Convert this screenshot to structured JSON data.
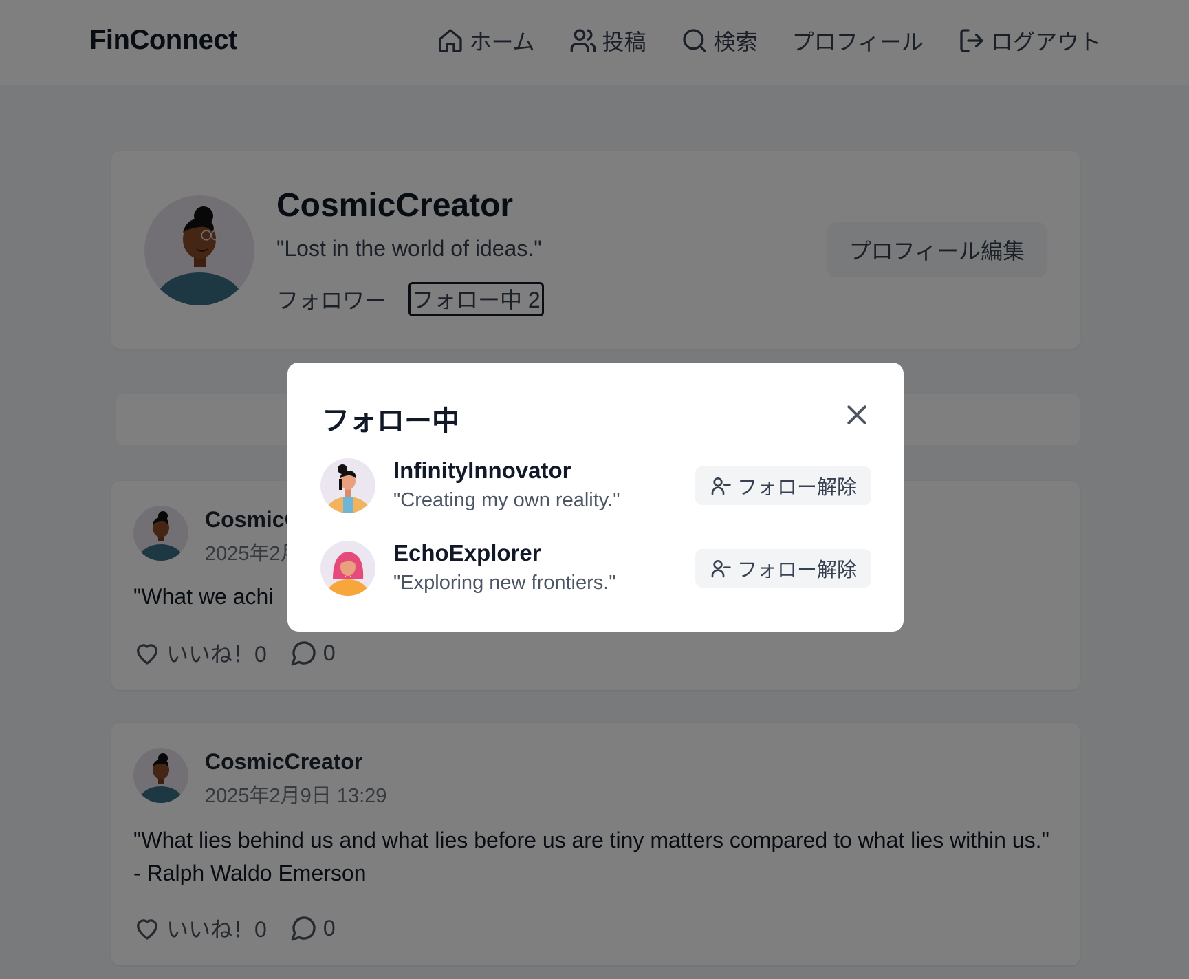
{
  "nav": {
    "brand": "FinConnect",
    "links": [
      {
        "label": "ホーム",
        "icon": "home-icon"
      },
      {
        "label": "投稿",
        "icon": "users-icon"
      },
      {
        "label": "検索",
        "icon": "search-icon"
      },
      {
        "label": "プロフィール",
        "icon": ""
      },
      {
        "label": "ログアウト",
        "icon": "logout-icon"
      }
    ]
  },
  "profile": {
    "name": "CosmicCreator",
    "bio": "\"Lost in the world of ideas.\"",
    "followers_label": "フォロワー",
    "following_label": "フォロー中 2",
    "edit_label": "プロフィール編集"
  },
  "posts": [
    {
      "author": "CosmicCreator",
      "date": "2025年2月",
      "body": "\"What we achi",
      "likes_label": "いいね！0",
      "comments": "0"
    },
    {
      "author": "CosmicCreator",
      "date": "2025年2月9日 13:29",
      "body": "\"What lies behind us and what lies before us are tiny matters compared to what lies within us.\" - Ralph Waldo Emerson",
      "likes_label": "いいね！0",
      "comments": "0"
    }
  ],
  "modal": {
    "title": "フォロー中",
    "users": [
      {
        "name": "InfinityInnovator",
        "bio": "\"Creating my own reality.\"",
        "button": "フォロー解除"
      },
      {
        "name": "EchoExplorer",
        "bio": "\"Exploring new frontiers.\"",
        "button": "フォロー解除"
      }
    ]
  },
  "colors": {
    "overlay": "#000000",
    "card": "#ffffff",
    "avatar_bg": "#e5e1ea",
    "shirt": "#3b6e86"
  }
}
